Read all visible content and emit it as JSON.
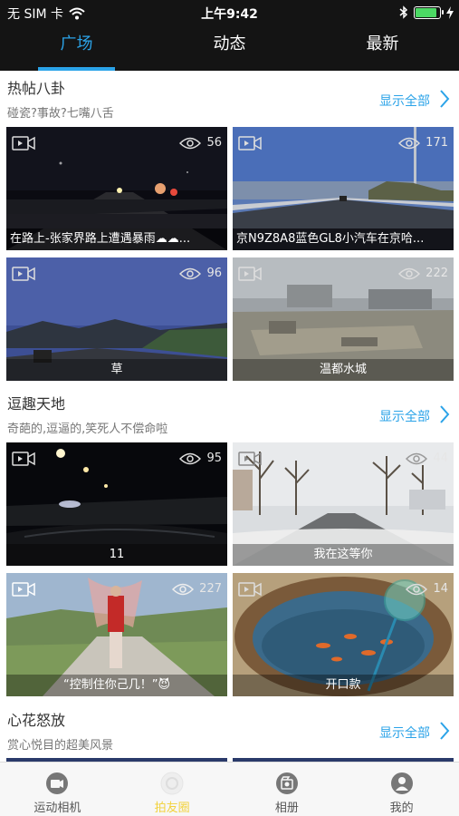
{
  "status_bar": {
    "carrier": "无 SIM 卡",
    "time": "上午9:42",
    "battery_level": 0.95
  },
  "top_tabs": [
    {
      "label": "广场",
      "active": true
    },
    {
      "label": "动态",
      "active": false
    },
    {
      "label": "最新",
      "active": false
    }
  ],
  "sections": [
    {
      "title": "热帖八卦",
      "subtitle": "碰瓷?事故?七嘴八舌",
      "show_all": "显示全部",
      "videos": [
        {
          "views": "56",
          "caption": "在路上-张家界路上遭遇暴雨☁☁..."
        },
        {
          "views": "171",
          "caption": "京N9Z8A8蓝色GL8小汽车在京哈..."
        },
        {
          "views": "96",
          "caption": "草"
        },
        {
          "views": "222",
          "caption": "温都水城"
        }
      ]
    },
    {
      "title": "逗趣天地",
      "subtitle": "奇葩的,逗逼的,笑死人不偿命啦",
      "show_all": "显示全部",
      "videos": [
        {
          "views": "95",
          "caption": "11"
        },
        {
          "views": "44",
          "caption": "我在这等你"
        },
        {
          "views": "227",
          "caption": "“控制住你己几！”😈"
        },
        {
          "views": "14",
          "caption": "开口款"
        }
      ]
    },
    {
      "title": "心花怒放",
      "subtitle": "赏心悦目的超美风景",
      "show_all": "显示全部"
    }
  ],
  "bottom_tabs": [
    {
      "label": "运动相机",
      "icon": "camera-icon",
      "active": false
    },
    {
      "label": "拍友圈",
      "icon": "friends-circle-icon",
      "active": true
    },
    {
      "label": "相册",
      "icon": "album-icon",
      "active": false
    },
    {
      "label": "我的",
      "icon": "profile-icon",
      "active": false
    }
  ],
  "colors": {
    "accent": "#2ba3e8",
    "active_bottom": "#f2d23c",
    "header_bg": "#141414"
  }
}
